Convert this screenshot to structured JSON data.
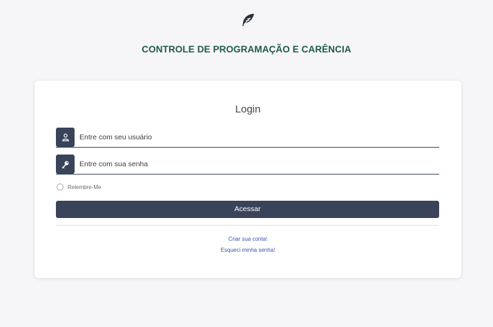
{
  "app": {
    "logo_icon": "feather-icon",
    "title": "CONTROLE DE PROGRAMAÇÃO E CARÊNCIA",
    "title_color": "#1f5a48"
  },
  "login": {
    "heading": "Login",
    "username": {
      "icon": "user-icon",
      "placeholder": "Entre com seu usuário",
      "value": ""
    },
    "password": {
      "icon": "key-icon",
      "placeholder": "Entre com sua senha",
      "value": ""
    },
    "remember_label": "Relembre-Me",
    "remember_checked": false,
    "submit_label": "Acessar",
    "signup_link": "Criar sua conta!",
    "forgot_link": "Esqueci minha senha!"
  },
  "colors": {
    "primary": "#394359",
    "link": "#3b52b0",
    "background": "#f6f6f8"
  }
}
